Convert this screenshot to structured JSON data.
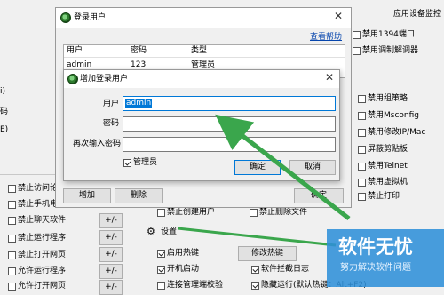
{
  "background": {
    "top_right_menu": "应用设备监控",
    "right_checks": [
      {
        "label": "禁用1394端口",
        "checked": false
      },
      {
        "label": "禁用调制解调器",
        "checked": false
      }
    ],
    "right_checks2": [
      {
        "label": "禁用组策略",
        "checked": false
      },
      {
        "label": "禁用Msconfig",
        "checked": false
      },
      {
        "label": "禁用修改IP/Mac",
        "checked": false
      },
      {
        "label": "屏蔽剪贴板",
        "checked": false
      },
      {
        "label": "禁用Telnet",
        "checked": false
      },
      {
        "label": "禁用虚拟机",
        "checked": false
      },
      {
        "label": "禁止打印",
        "checked": false
      }
    ],
    "left_fragments": [
      "i)",
      "码",
      "E)"
    ],
    "left_checks": [
      {
        "label": "禁止访问论",
        "checked": false
      },
      {
        "label": "禁止手机电",
        "checked": false
      },
      {
        "label": "禁止聊天软件",
        "checked": false,
        "btn": "+/-"
      },
      {
        "label": "禁止运行程序",
        "checked": false,
        "btn": "+/-"
      },
      {
        "label": "禁止打开网页",
        "checked": false,
        "btn": "+/-"
      },
      {
        "label": "允许运行程序",
        "checked": false,
        "btn": "+/-"
      },
      {
        "label": "允许打开网页",
        "checked": false,
        "btn": "+/-"
      }
    ],
    "mid_checks": [
      {
        "label": "禁止创建用户",
        "checked": false
      },
      {
        "label": "禁止删除文件",
        "checked": false
      }
    ],
    "settings_label": "设置",
    "settings_checks": [
      {
        "label": "启用热键",
        "checked": true
      },
      {
        "label": "开机启动",
        "checked": true
      },
      {
        "label": "软件拦截日志",
        "checked": true
      },
      {
        "label": "连接管理端校验",
        "checked": false
      },
      {
        "label": "隐藏运行(默认热键：Alt+F2)",
        "checked": true
      }
    ],
    "hotkey_button": "修改热键"
  },
  "login_dialog": {
    "title": "登录用户",
    "help_link": "查看帮助",
    "columns": [
      "用户",
      "密码",
      "类型"
    ],
    "rows": [
      {
        "user": "admin",
        "password": "123",
        "type": "管理员"
      }
    ],
    "add_button": "增加",
    "delete_button": "删除",
    "ok_button": "确定"
  },
  "add_dialog": {
    "title": "增加登录用户",
    "user_label": "用户",
    "user_value": "admin",
    "password_label": "密码",
    "confirm_label": "再次输入密码",
    "admin_check_label": "管理员",
    "admin_checked": true,
    "ok_button": "确定",
    "cancel_button": "取消"
  },
  "watermark": {
    "brand": "软件无忧",
    "slogan": "努力解决软件问题"
  },
  "colors": {
    "arrow": "#3aa64c",
    "selection": "#0078d7",
    "watermark_bg": "#2f8fd8"
  }
}
